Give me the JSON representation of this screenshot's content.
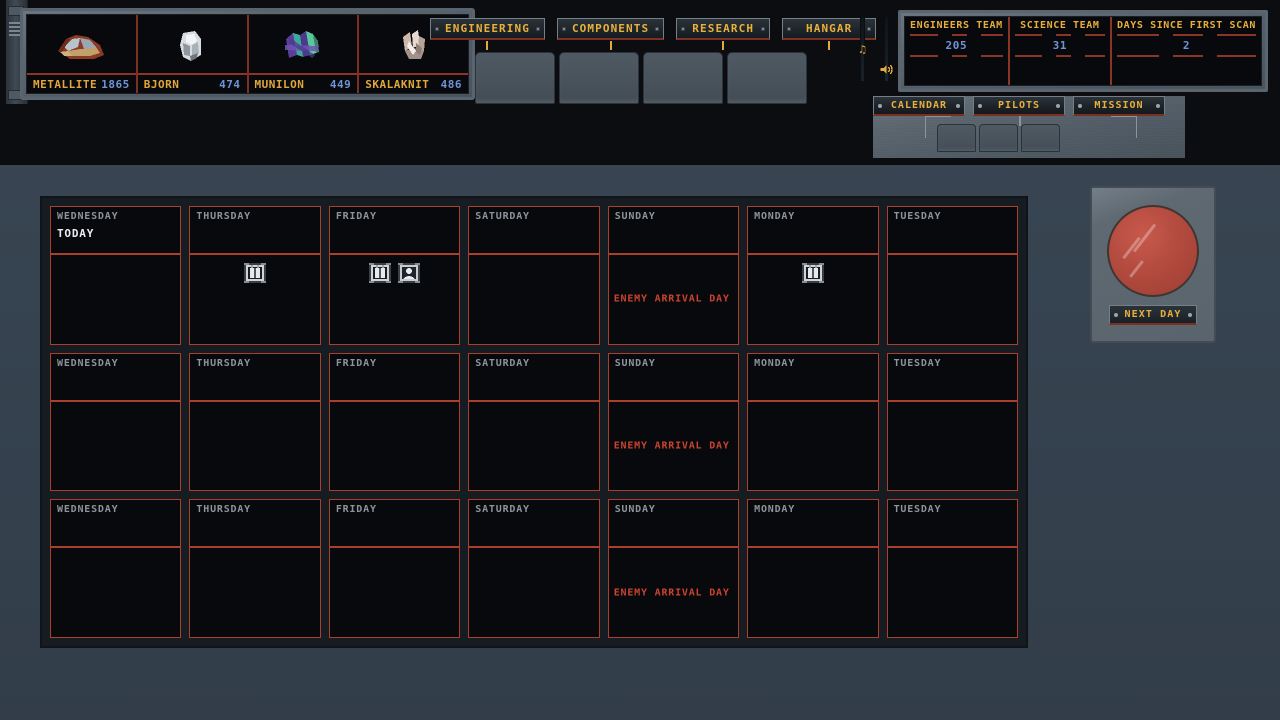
{
  "resources": [
    {
      "name": "METALLITE",
      "value": "1865",
      "icon": "metallite-ore-icon"
    },
    {
      "name": "BJORN",
      "value": "474",
      "icon": "bjorn-ore-icon"
    },
    {
      "name": "MUNILON",
      "value": "449",
      "icon": "munilon-ore-icon"
    },
    {
      "name": "SKALAKNIT",
      "value": "486",
      "icon": "skalaknit-ore-icon"
    }
  ],
  "main_tabs": [
    {
      "label": "ENGINEERING"
    },
    {
      "label": "COMPONENTS"
    },
    {
      "label": "RESEARCH"
    },
    {
      "label": "HANGAR"
    }
  ],
  "sliders": [
    {
      "name": "music-slider",
      "icon": "music-note-icon",
      "glyph": "♫",
      "position_pct": 42
    },
    {
      "name": "sound-slider",
      "icon": "speaker-icon",
      "glyph": "🔊",
      "position_pct": 78
    }
  ],
  "stats": [
    {
      "title": "ENGINEERS TEAM",
      "value": "205"
    },
    {
      "title": "SCIENCE TEAM",
      "value": "31"
    },
    {
      "title": "DAYS SINCE FIRST SCAN",
      "value": "2"
    }
  ],
  "sub_tabs": [
    {
      "label": "CALENDAR"
    },
    {
      "label": "PILOTS"
    },
    {
      "label": "MISSION"
    }
  ],
  "calendar": {
    "weeks": [
      [
        {
          "day": "WEDNESDAY",
          "today": "TODAY",
          "note": "",
          "events": []
        },
        {
          "day": "THURSDAY",
          "today": "",
          "note": "",
          "events": [
            "cargo-crate-icon"
          ]
        },
        {
          "day": "FRIDAY",
          "today": "",
          "note": "",
          "events": [
            "cargo-crate-icon",
            "pilot-portrait-icon"
          ]
        },
        {
          "day": "SATURDAY",
          "today": "",
          "note": "",
          "events": []
        },
        {
          "day": "SUNDAY",
          "today": "",
          "note": "ENEMY ARRIVAL DAY",
          "events": []
        },
        {
          "day": "MONDAY",
          "today": "",
          "note": "",
          "events": [
            "cargo-crate-icon"
          ]
        },
        {
          "day": "TUESDAY",
          "today": "",
          "note": "",
          "events": []
        }
      ],
      [
        {
          "day": "WEDNESDAY",
          "today": "",
          "note": "",
          "events": []
        },
        {
          "day": "THURSDAY",
          "today": "",
          "note": "",
          "events": []
        },
        {
          "day": "FRIDAY",
          "today": "",
          "note": "",
          "events": []
        },
        {
          "day": "SATURDAY",
          "today": "",
          "note": "",
          "events": []
        },
        {
          "day": "SUNDAY",
          "today": "",
          "note": "ENEMY ARRIVAL DAY",
          "events": []
        },
        {
          "day": "MONDAY",
          "today": "",
          "note": "",
          "events": []
        },
        {
          "day": "TUESDAY",
          "today": "",
          "note": "",
          "events": []
        }
      ],
      [
        {
          "day": "WEDNESDAY",
          "today": "",
          "note": "",
          "events": []
        },
        {
          "day": "THURSDAY",
          "today": "",
          "note": "",
          "events": []
        },
        {
          "day": "FRIDAY",
          "today": "",
          "note": "",
          "events": []
        },
        {
          "day": "SATURDAY",
          "today": "",
          "note": "",
          "events": []
        },
        {
          "day": "SUNDAY",
          "today": "",
          "note": "ENEMY ARRIVAL DAY",
          "events": []
        },
        {
          "day": "MONDAY",
          "today": "",
          "note": "",
          "events": []
        },
        {
          "day": "TUESDAY",
          "today": "",
          "note": "",
          "events": []
        }
      ]
    ]
  },
  "next_day": {
    "label": "NEXT DAY",
    "button_icon": "red-round-button-icon"
  },
  "colors": {
    "accent_gold": "#e9b03c",
    "accent_red": "#a8402c",
    "value_blue": "#6f94d6",
    "enemy_red": "#c9432f",
    "panel_metal": "#5c666f",
    "screen_black": "#08090c",
    "desk_bg": "#364350"
  }
}
